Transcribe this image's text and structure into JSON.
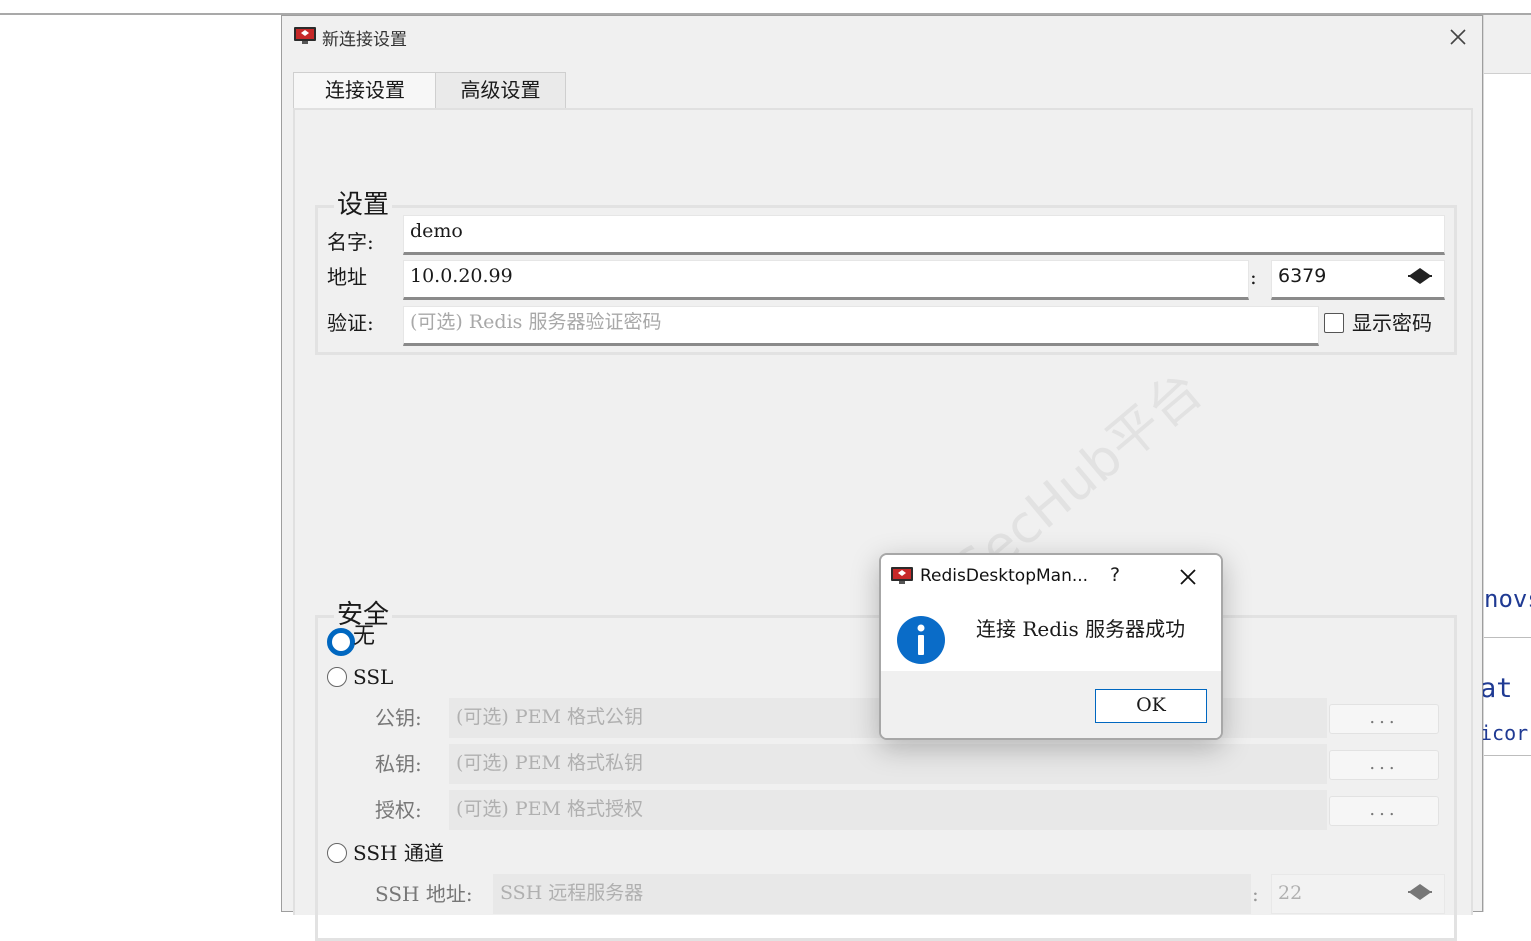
{
  "background_window": {
    "fragments": [
      "novs",
      "at",
      "icor"
    ]
  },
  "dialog": {
    "title": "新连接设置",
    "tabs": [
      {
        "label": "连接设置",
        "active": true
      },
      {
        "label": "高级设置",
        "active": false
      }
    ],
    "settings_group": {
      "title": "设置",
      "name_label": "名字:",
      "name_value": "demo",
      "address_label": "地址",
      "host_value": "10.0.20.99",
      "port_separator": ":",
      "port_value": "6379",
      "auth_label": "验证:",
      "auth_placeholder": "(可选) Redis 服务器验证密码",
      "show_password_label": "显示密码",
      "show_password_checked": false
    },
    "security_group": {
      "title": "安全",
      "options": {
        "none": "无",
        "ssl": "SSL",
        "ssh": "SSH 通道"
      },
      "selected": "无",
      "public_key_label": "公钥:",
      "public_key_placeholder": "(可选) PEM 格式公钥",
      "private_key_label": "私钥:",
      "private_key_placeholder": "(可选) PEM 格式私钥",
      "authority_label": "授权:",
      "authority_placeholder": "(可选) PEM 格式授权",
      "browse_label": "...",
      "ssh_address_label": "SSH 地址:",
      "ssh_address_placeholder": "SSH 远程服务器",
      "ssh_port_separator": ":",
      "ssh_port_placeholder": "22"
    },
    "watermark": "SecHub平台"
  },
  "message_box": {
    "title": "RedisDesktopMan...",
    "help_label": "?",
    "text": "连接 Redis 服务器成功",
    "ok_label": "OK"
  },
  "colors": {
    "accent": "#0067c0",
    "dialog_bg": "#f0f0f0",
    "app_icon_red": "#c62828"
  }
}
